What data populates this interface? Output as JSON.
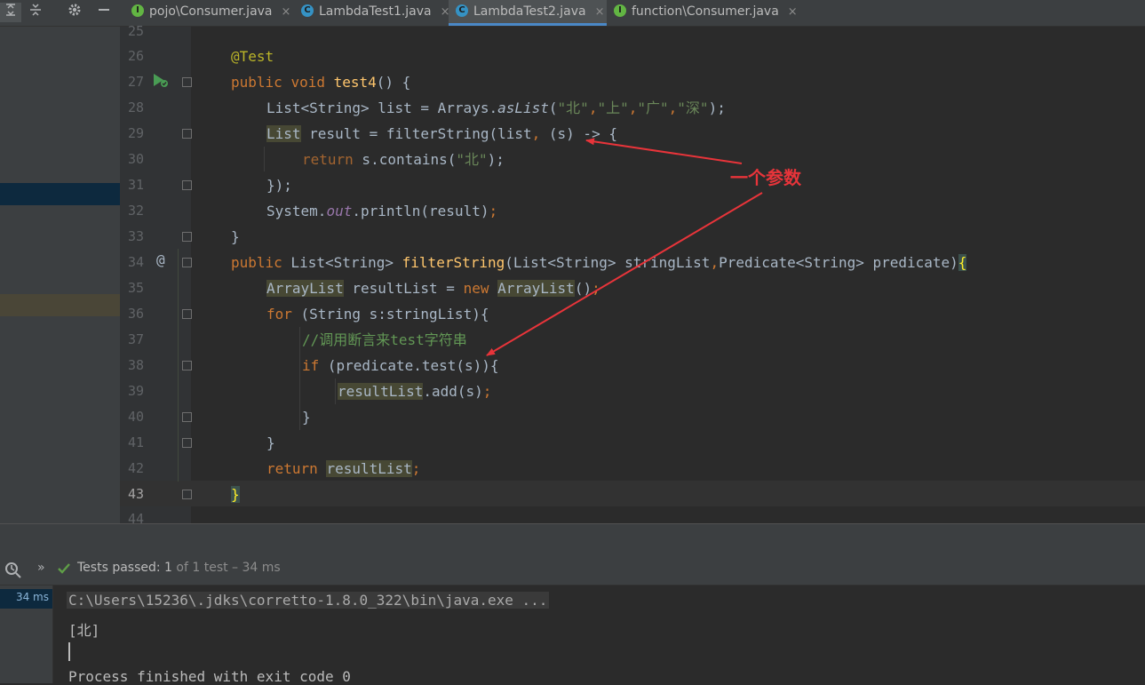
{
  "toolbar": {
    "collapse_icon": "collapse-all-icon",
    "expand_icon": "expand-all-icon",
    "settings_icon": "gear-icon",
    "hide_icon": "minus-icon"
  },
  "tabs": [
    {
      "label": "pojo\\Consumer.java",
      "icon": "I",
      "active": false
    },
    {
      "label": "LambdaTest1.java",
      "icon": "C",
      "active": false
    },
    {
      "label": "LambdaTest2.java",
      "icon": "C",
      "active": true
    },
    {
      "label": "function\\Consumer.java",
      "icon": "I",
      "active": false
    }
  ],
  "close_glyph": "×",
  "line_numbers": [
    "25",
    "26",
    "27",
    "28",
    "29",
    "30",
    "31",
    "32",
    "33",
    "34",
    "35",
    "36",
    "37",
    "38",
    "39",
    "40",
    "41",
    "42",
    "43",
    "44"
  ],
  "code": {
    "l26_anno": "@Test",
    "kw_public": "public",
    "kw_void": "void",
    "l27_name": "test4",
    "l27_rest": "() {",
    "l28_a": "List<String> list = Arrays.",
    "l28_b": "asList",
    "l28_c": "(",
    "str_bei": "\"北\"",
    "str_shang": "\"上\"",
    "str_guang": "\"广\"",
    "str_shen": "\"深\"",
    "comma": ",",
    "l28_end": ");",
    "l29_list": "List",
    "l29_a": " result = filterString(list",
    "l29_b": " (s) -> {",
    "kw_return": "return",
    "l30_a": " s.contains(",
    "l30_end": ");",
    "l31": "});",
    "l32_a": "System.",
    "l32_out": "out",
    "l32_b": ".println(result)",
    "semi": ";",
    "rbrace": "}",
    "l34_a": " List<String> ",
    "l34_name": "filterString",
    "l34_b": "(List<String> stringList",
    "l34_c": "Predicate<String> predicate)",
    "lbrace": "{",
    "al": "ArrayList",
    "l35_a": " resultList = ",
    "kw_new": "new",
    "l35_b": "()",
    "kw_for": "for",
    "l36_a": " (String s:stringList){",
    "l37_comment": "//调用断言来test字符串",
    "kw_if": "if",
    "l38_a": " (predicate.test(s)){",
    "l39_a": "resultList",
    "l39_b": ".add(s)",
    "rl": "resultList"
  },
  "annotation": {
    "text": "一个参数",
    "color": "#e8343a"
  },
  "run": {
    "clock_icon": "clock-icon",
    "more_icon": "double-chevron-icon",
    "check_icon": "check-icon",
    "passed_label": "Tests passed:",
    "passed_count": "1",
    "passed_rest": "of 1 test – 34 ms",
    "tree_time": "34 ms"
  },
  "console": {
    "line1": "C:\\Users\\15236\\.jdks\\corretto-1.8.0_322\\bin\\java.exe ...",
    "line2": "[北]",
    "line3": "Process finished with exit code 0"
  }
}
